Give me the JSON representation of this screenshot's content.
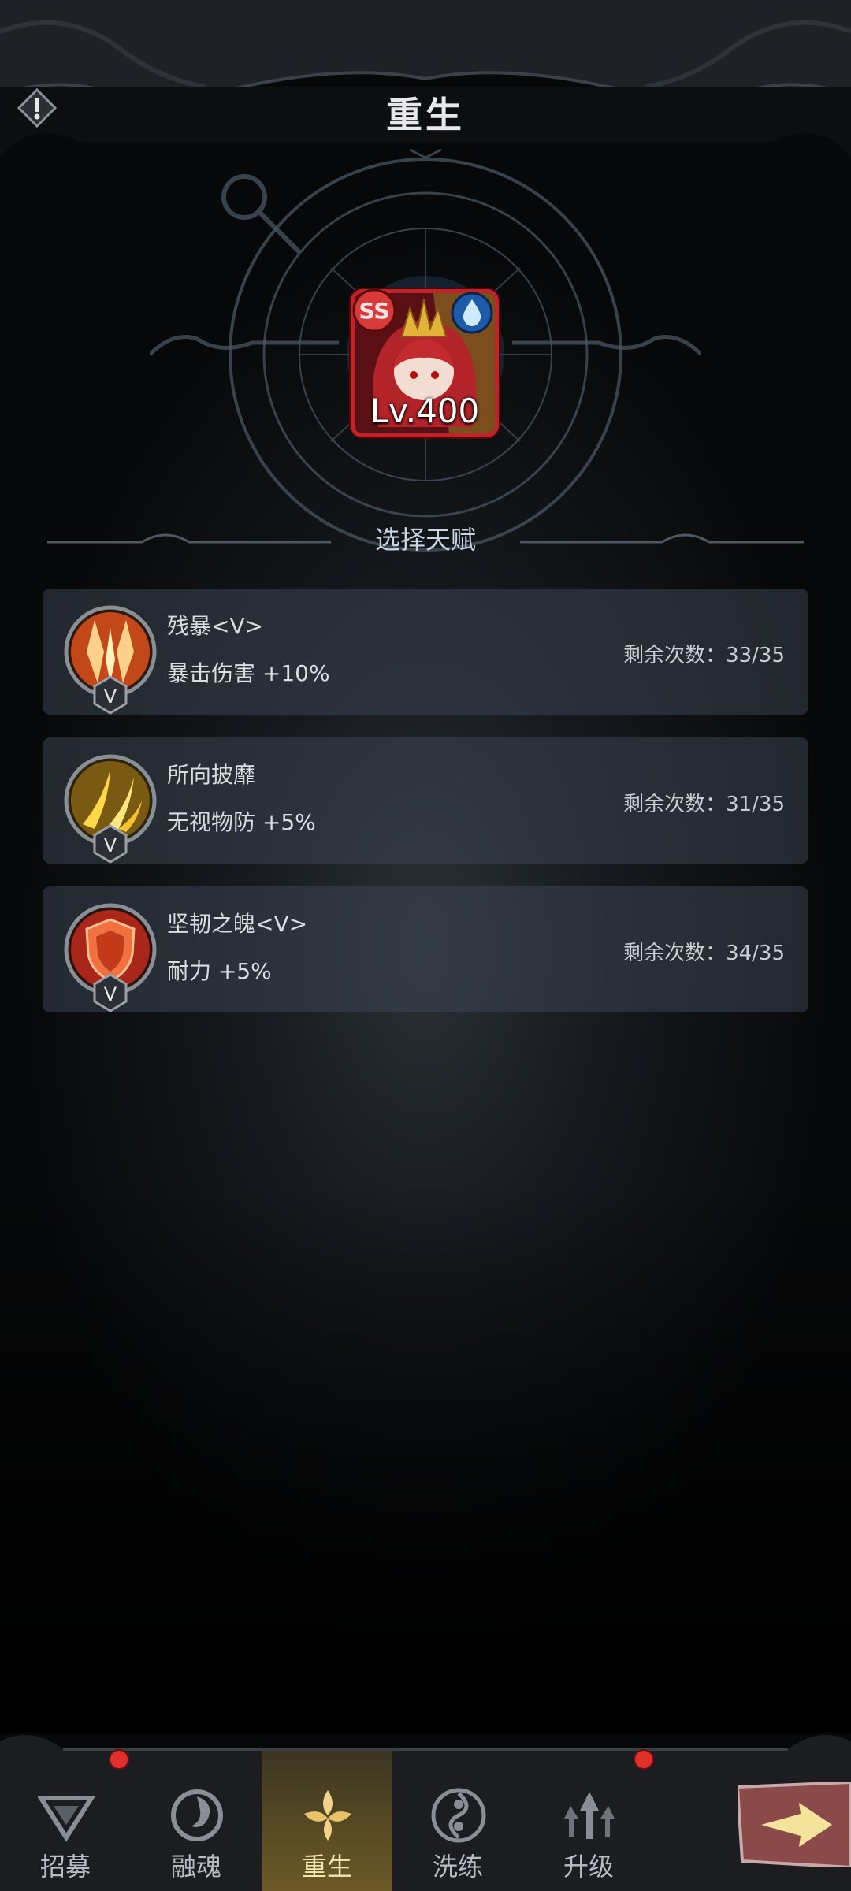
{
  "header": {
    "title": "重生"
  },
  "hero": {
    "level": "Lv.400",
    "rank": "SS"
  },
  "talents": {
    "section_title": "选择天赋",
    "items": [
      {
        "name": "残暴<Ⅴ>",
        "effect": "暴击伤害 +10%",
        "remaining": "剩余次数：33/35",
        "grade": "V"
      },
      {
        "name": "所向披靡",
        "effect": "无视物防 +5%",
        "remaining": "剩余次数：31/35",
        "grade": "V"
      },
      {
        "name": "坚韧之魄<Ⅴ>",
        "effect": "耐力 +5%",
        "remaining": "剩余次数：34/35",
        "grade": "V"
      }
    ]
  },
  "nav": {
    "tabs": [
      {
        "label": "招募",
        "icon": "recruit-icon"
      },
      {
        "label": "融魂",
        "icon": "soul-fusion-icon"
      },
      {
        "label": "重生",
        "icon": "rebirth-icon"
      },
      {
        "label": "洗练",
        "icon": "refine-icon"
      },
      {
        "label": "升级",
        "icon": "upgrade-icon"
      }
    ],
    "active_tab": "重生"
  },
  "colors": {
    "accent_gold": "#f4e6b2",
    "badge_red": "#e0302c",
    "hero_frame": "#c02428"
  }
}
